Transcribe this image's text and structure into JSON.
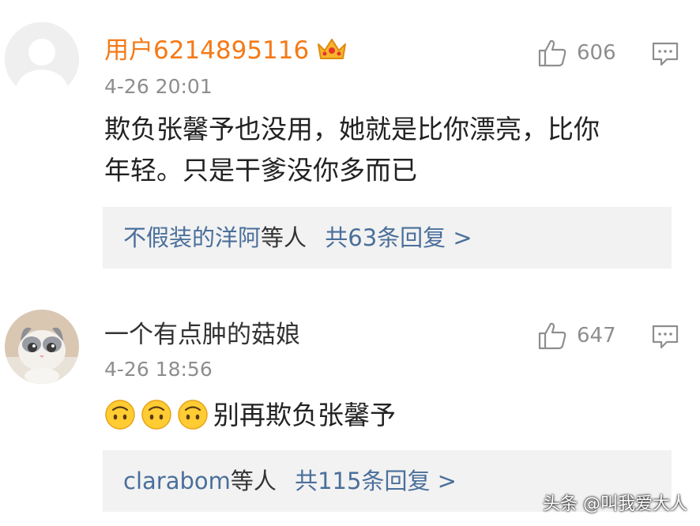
{
  "comments": [
    {
      "username": "用户6214895116",
      "time": "4-26 20:01",
      "text_line1": "欺负张馨予也没用，她就是比你漂亮，比你",
      "text_line2": "年轻。只是干爹没你多而已",
      "likes": "606",
      "reply_users": "不假装的洋阿",
      "reply_mid": "等人",
      "reply_summary": "共63条回复 >"
    },
    {
      "username": "一个有点肿的菇娘",
      "time": "4-26 18:56",
      "text": "别再欺负张馨予",
      "likes": "647",
      "reply_users": "clarabom",
      "reply_mid": "等人",
      "reply_summary": "共115条回复 >"
    }
  ],
  "watermark": "头条 @叫我爱大人",
  "colors": {
    "vip_name": "#f57a18",
    "reply_link": "#4a6f9b",
    "reply_bg": "#f2f2f2",
    "meta": "#8e8e8e"
  },
  "icons": [
    "crown-icon",
    "thumbs-up-icon",
    "comment-icon",
    "upside-down-face-emoji"
  ]
}
